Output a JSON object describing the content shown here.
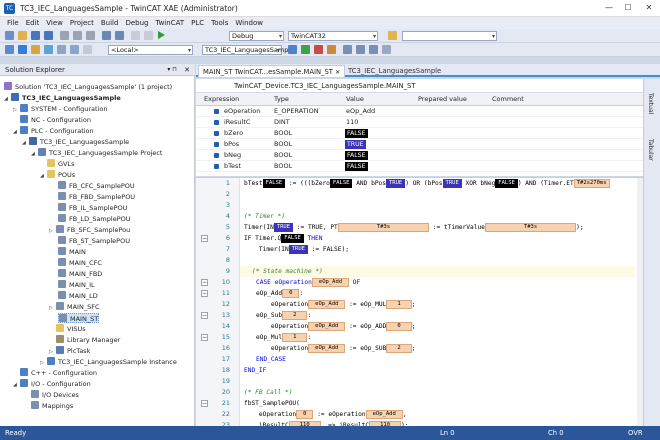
{
  "window": {
    "title": "TC3_IEC_LanguagesSample - TwinCAT XAE (Administrator)",
    "minimize": "—",
    "maximize": "☐",
    "close": "✕"
  },
  "menu": [
    "File",
    "Edit",
    "View",
    "Project",
    "Build",
    "Debug",
    "TwinCAT",
    "PLC",
    "Tools",
    "Window"
  ],
  "toolbar": {
    "config": "Debug",
    "platform": "TwinCAT32",
    "target": "<Local>",
    "project": "TC3_IEC_LanguagesSamp"
  },
  "solution_explorer": {
    "title": "Solution Explorer",
    "items": [
      "Solution 'TC3_IEC_LanguagesSample' (1 project)",
      "TC3_IEC_LanguagesSample",
      "SYSTEM - Configuration",
      "NC - Configuration",
      "PLC - Configuration",
      "TC3_IEC_LanguagesSample",
      "TC3_IEC_LanguagesSample Project",
      "GVLs",
      "POUs",
      "FB_CFC_SamplePOU",
      "FB_FBD_SamplePOU",
      "FB_IL_SamplePOU",
      "FB_LD_SamplePOU",
      "FB_SFC_SamplePou",
      "FB_ST_SamplePOU",
      "MAIN",
      "MAIN_CFC",
      "MAIN_FBD",
      "MAIN_IL",
      "MAIN_LD",
      "MAIN_SFC",
      "MAIN_ST",
      "VISUs",
      "Library Manager",
      "PlcTask",
      "TC3_IEC_LanguagesSample Instance",
      "C++ - Configuration",
      "I/O - Configuration",
      "I/O Devices",
      "Mappings"
    ]
  },
  "tabs": [
    "MAIN_ST TwinCAT...esSample.MAIN_ST",
    "TC3_IEC_LanguagesSample"
  ],
  "declaration": "TwinCAT_Device.TC3_IEC_LanguagesSample.MAIN_ST",
  "watch": {
    "headers": [
      "Expression",
      "Type",
      "Value",
      "Prepared value",
      "Comment"
    ],
    "rows": [
      {
        "expr": "eOperation",
        "type": "E_OPERATION",
        "value": "eOp_Add"
      },
      {
        "expr": "iResultC",
        "type": "DINT",
        "value": "110"
      },
      {
        "expr": "bZero",
        "type": "BOOL",
        "value": "FALSE"
      },
      {
        "expr": "bPos",
        "type": "BOOL",
        "value": "TRUE"
      },
      {
        "expr": "bNeg",
        "type": "BOOL",
        "value": "FALSE"
      },
      {
        "expr": "bTest",
        "type": "BOOL",
        "value": "FALSE"
      }
    ]
  },
  "side_tabs": [
    "Textual",
    "Tabular"
  ],
  "code": {
    "line_numbers": [
      "1",
      "2",
      "3",
      "4",
      "5",
      "6",
      "7",
      "8",
      "9",
      "10",
      "11",
      "12",
      "13",
      "14",
      "15",
      "16",
      "17",
      "18",
      "19",
      "20",
      "21",
      "22",
      "23"
    ],
    "l1": {
      "a": "bTest",
      "b": "FALSE",
      "c": " := (((bZero",
      "d": "FALSE",
      "e": " AND bPos",
      "f": "TRUE",
      "g": ") OR (bPos",
      "h": "TRUE",
      "i": " XOR bNeg",
      "j": "FALSE",
      "k": ") AND (Timer.ET",
      "l": "T#2s270ms"
    },
    "l4": "(* Timer *)",
    "l5": {
      "a": "Timer(IN",
      "b": "TRUE",
      "c": " := TRUE, PT",
      "d": "T#3s",
      "e": " := tTimerValue",
      "f": "T#3s",
      "g": ");"
    },
    "l6": {
      "a": "IF Timer.Q",
      "b": "FALSE",
      "c": " THEN"
    },
    "l7": {
      "a": "    Timer(IN",
      "b": "TRUE",
      "c": " := FALSE);"
    },
    "l9": "(* State machine *)",
    "l10": {
      "a": "CASE eOperation",
      "b": "eOp_Add",
      "c": " OF"
    },
    "l11": {
      "a": "eOp_Add",
      "b": "0",
      "c": ":"
    },
    "l12": {
      "a": "    eOperation",
      "b": "eOp_Add",
      "c": " := eOp_MUL",
      "d": "1",
      "e": ";"
    },
    "l13": {
      "a": "eOp_Sub",
      "b": "2",
      "c": ":"
    },
    "l14": {
      "a": "    eOperation",
      "b": "eOp_Add",
      "c": " := eOp_ADD",
      "d": "0",
      "e": ";"
    },
    "l15": {
      "a": "eOp_Mul",
      "b": "1",
      "c": ":"
    },
    "l16": {
      "a": "    eOperation",
      "b": "eOp_Add",
      "c": " := eOp_SUB",
      "d": "2",
      "e": ";"
    },
    "l17": "END_CASE",
    "l18": "END_IF",
    "l20": "(* FB Call *)",
    "l21": "fbST_SamplePOU(",
    "l22": {
      "a": "    eOperation",
      "b": "0",
      "c": " := eOperation",
      "d": "eOp_Add",
      "e": ","
    },
    "l23": {
      "a": "    iResultC",
      "b": "110",
      "c": "  => iResultC",
      "d": "110",
      "e": ");"
    }
  },
  "status": {
    "state": "Ready",
    "line": "Ln 0",
    "col": "Ch 0",
    "mode": "OVR"
  }
}
